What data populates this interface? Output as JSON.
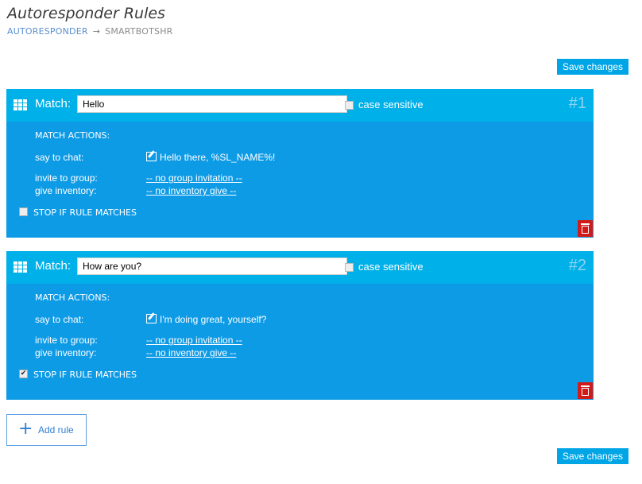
{
  "page": {
    "title": "Autoresponder Rules",
    "breadcrumb": {
      "link": "AUTORESPONDER",
      "separator": "→",
      "current": "SMARTBOTSHR"
    }
  },
  "buttons": {
    "save_label": "Save changes",
    "add_rule_label": "Add rule",
    "add_rule_icon": "+"
  },
  "labels": {
    "match": "Match:",
    "case_sensitive": "case sensitive",
    "match_actions": "MATCH ACTIONS:",
    "say_to_chat": "say to chat:",
    "invite_to_group": "invite to group:",
    "give_inventory": "give inventory:",
    "stop_if_match": "STOP IF RULE MATCHES"
  },
  "rules": [
    {
      "number": "#1",
      "match_value": "Hello",
      "case_sensitive": false,
      "say_to_chat": "Hello there, %SL_NAME%!",
      "invite_to_group": "-- no group invitation --",
      "give_inventory": "-- no inventory give --",
      "stop_if_match": false,
      "stop_mark": ""
    },
    {
      "number": "#2",
      "match_value": "How are you?",
      "case_sensitive": false,
      "say_to_chat": "I'm doing great, yourself?",
      "invite_to_group": "-- no group invitation --",
      "give_inventory": "-- no inventory give --",
      "stop_if_match": true,
      "stop_mark": "✔"
    }
  ],
  "colors": {
    "header": "#00b0e8",
    "body": "#0e9be6",
    "save_button": "#00a5e6",
    "delete": "#d11b1b"
  }
}
